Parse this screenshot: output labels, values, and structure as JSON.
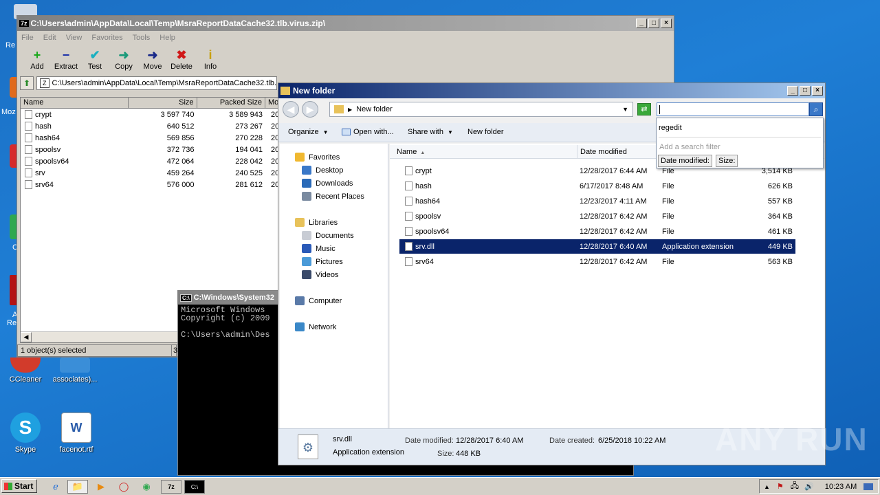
{
  "desktop": {
    "icons": [
      {
        "label": "CCleaner"
      },
      {
        "label": "associates)..."
      },
      {
        "label": "Skype"
      },
      {
        "label": "facenot.rtf"
      }
    ],
    "partial_labels": {
      "re": "Re",
      "moz": "Moz",
      "c": "C",
      "a": "A",
      "re2": "Re"
    }
  },
  "sevenzip": {
    "title": "C:\\Users\\admin\\AppData\\Local\\Temp\\MsraReportDataCache32.tlb.virus.zip\\",
    "menu": [
      "File",
      "Edit",
      "View",
      "Favorites",
      "Tools",
      "Help"
    ],
    "tools": [
      {
        "label": "Add",
        "icon": "+",
        "color": "#1aa81a"
      },
      {
        "label": "Extract",
        "icon": "−",
        "color": "#1a2fa8"
      },
      {
        "label": "Test",
        "icon": "✔",
        "color": "#1ab0c0"
      },
      {
        "label": "Copy",
        "icon": "➜",
        "color": "#1a9a7a"
      },
      {
        "label": "Move",
        "icon": "➜",
        "color": "#1a2a8a"
      },
      {
        "label": "Delete",
        "icon": "✖",
        "color": "#d01818"
      },
      {
        "label": "Info",
        "icon": "i",
        "color": "#c8a010"
      }
    ],
    "address": "C:\\Users\\admin\\AppData\\Local\\Temp\\MsraReportDataCache32.tlb.",
    "columns": {
      "name": "Name",
      "size": "Size",
      "packed": "Packed Size",
      "mod": "Mo"
    },
    "files": [
      {
        "name": "crypt",
        "size": "3 597 740",
        "packed": "3 589 943",
        "mod": "20"
      },
      {
        "name": "hash",
        "size": "640 512",
        "packed": "273 267",
        "mod": "20"
      },
      {
        "name": "hash64",
        "size": "569 856",
        "packed": "270 228",
        "mod": "20"
      },
      {
        "name": "spoolsv",
        "size": "372 736",
        "packed": "194 041",
        "mod": "20"
      },
      {
        "name": "spoolsv64",
        "size": "472 064",
        "packed": "228 042",
        "mod": "20"
      },
      {
        "name": "srv",
        "size": "459 264",
        "packed": "240 525",
        "mod": "20"
      },
      {
        "name": "srv64",
        "size": "576 000",
        "packed": "281 612",
        "mod": "20"
      }
    ],
    "status": "1 object(s) selected",
    "status2": "3"
  },
  "cmd": {
    "title": "C:\\Windows\\System32",
    "line1": "Microsoft Windows",
    "line2": "Copyright (c) 2009",
    "line3": "C:\\Users\\admin\\Des"
  },
  "explorer": {
    "title": "New folder",
    "breadcrumb": "New folder",
    "search_value": "",
    "search_suggestion": "regedit",
    "add_filter": "Add a search filter",
    "filter_date": "Date modified:",
    "filter_size": "Size:",
    "cmdbar": {
      "organize": "Organize",
      "open_with": "Open with...",
      "share_with": "Share with",
      "new_folder": "New folder"
    },
    "nav": {
      "favorites": "Favorites",
      "desktop": "Desktop",
      "downloads": "Downloads",
      "recent": "Recent Places",
      "libraries": "Libraries",
      "documents": "Documents",
      "music": "Music",
      "pictures": "Pictures",
      "videos": "Videos",
      "computer": "Computer",
      "network": "Network"
    },
    "columns": {
      "name": "Name",
      "date": "Date modified"
    },
    "files": [
      {
        "name": "crypt",
        "date": "12/28/2017 6:44 AM",
        "type": "File",
        "size": "3,514 KB"
      },
      {
        "name": "hash",
        "date": "6/17/2017 8:48 AM",
        "type": "File",
        "size": "626 KB"
      },
      {
        "name": "hash64",
        "date": "12/23/2017 4:11 AM",
        "type": "File",
        "size": "557 KB"
      },
      {
        "name": "spoolsv",
        "date": "12/28/2017 6:42 AM",
        "type": "File",
        "size": "364 KB"
      },
      {
        "name": "spoolsv64",
        "date": "12/28/2017 6:42 AM",
        "type": "File",
        "size": "461 KB"
      },
      {
        "name": "srv.dll",
        "date": "12/28/2017 6:40 AM",
        "type": "Application extension",
        "size": "449 KB"
      },
      {
        "name": "srv64",
        "date": "12/28/2017 6:42 AM",
        "type": "File",
        "size": "563 KB"
      }
    ],
    "details": {
      "name": "srv.dll",
      "type": "Application extension",
      "date_modified_label": "Date modified:",
      "date_modified": "12/28/2017 6:40 AM",
      "date_created_label": "Date created:",
      "date_created": "6/25/2018 10:22 AM",
      "size_label": "Size:",
      "size": "448 KB"
    }
  },
  "taskbar": {
    "start": "Start",
    "clock": "10:23 AM"
  },
  "watermark": "ANY RUN"
}
